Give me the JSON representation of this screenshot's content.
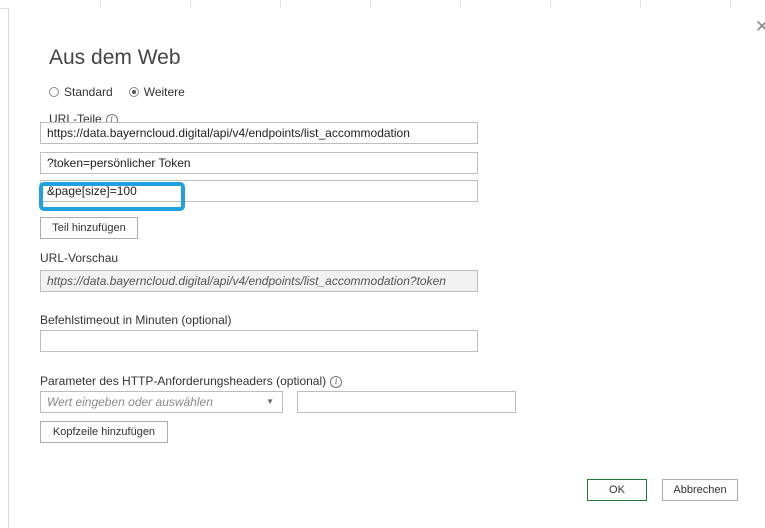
{
  "dialog": {
    "title": "Aus dem Web",
    "close_icon": "close-icon",
    "mode": {
      "options": [
        "Standard",
        "Weitere"
      ],
      "selected": "Weitere"
    },
    "url_parts": {
      "label": "URL-Teile",
      "parts": [
        "https://data.bayerncloud.digital/api/v4/endpoints/list_accommodation",
        "?token=persönlicher Token",
        "&page[size]=100"
      ],
      "add_part_label": "Teil hinzufügen"
    },
    "url_preview": {
      "label": "URL-Vorschau",
      "value": "https://data.bayerncloud.digital/api/v4/endpoints/list_accommodation?token"
    },
    "timeout": {
      "label": "Befehlstimeout in Minuten (optional)",
      "value": ""
    },
    "headers": {
      "label": "Parameter des HTTP-Anforderungsheaders (optional)",
      "name_placeholder": "Wert eingeben oder auswählen",
      "value": "",
      "add_header_label": "Kopfzeile hinzufügen"
    },
    "ok_label": "OK",
    "cancel_label": "Abbrechen",
    "highlight_color": "#1da1e0"
  }
}
